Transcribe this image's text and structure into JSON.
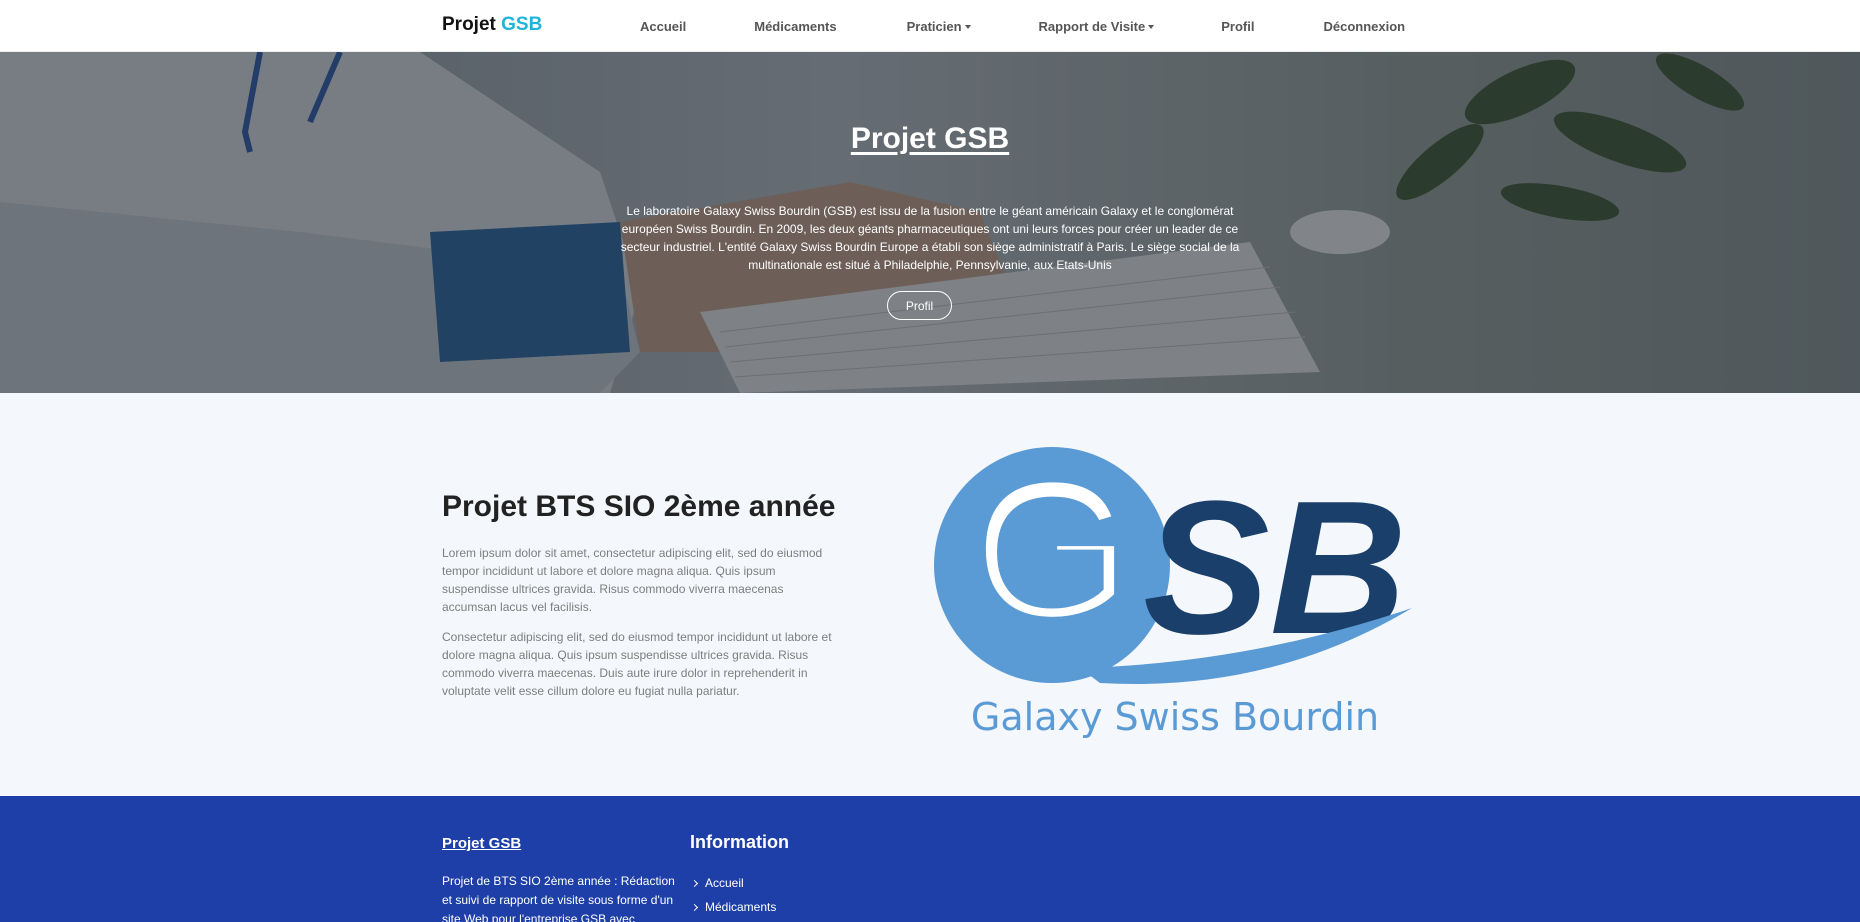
{
  "navbar": {
    "brand_main": "Projet",
    "brand_accent": "GSB",
    "links": [
      {
        "label": "Accueil"
      },
      {
        "label": "Médicaments"
      },
      {
        "label": "Praticien"
      },
      {
        "label": "Rapport de Visite"
      },
      {
        "label": "Profil"
      },
      {
        "label": "Déconnexion"
      }
    ]
  },
  "hero": {
    "title": "Projet GSB",
    "text": "Le laboratoire Galaxy Swiss Bourdin (GSB) est issu de la fusion entre le géant américain Galaxy et le conglomérat européen Swiss Bourdin. En 2009, les deux géants pharmaceutiques ont uni leurs forces pour créer un leader de ce secteur industriel. L'entité Galaxy Swiss Bourdin Europe a établi son siège administratif à Paris. Le siège social de la multinationale est situé à Philadelphie, Pennsylvanie, aux Etats-Unis",
    "button_label": "Profil"
  },
  "about": {
    "title": "Projet BTS SIO 2ème année",
    "paragraph1": "Lorem ipsum dolor sit amet, consectetur adipiscing elit, sed do eiusmod tempor incididunt ut labore et dolore magna aliqua. Quis ipsum suspendisse ultrices gravida. Risus commodo viverra maecenas accumsan lacus vel facilisis.",
    "paragraph2": "Consectetur adipiscing elit, sed do eiusmod tempor incididunt ut labore et dolore magna aliqua. Quis ipsum suspendisse ultrices gravida. Risus commodo viverra maecenas. Duis aute irure dolor in reprehenderit in voluptate velit esse cillum dolore eu fugiat nulla pariatur.",
    "logo": {
      "letters_g": "G",
      "letters_sb": "SB",
      "tagline": "Galaxy Swiss Bourdin",
      "light_blue": "#5b9bd5",
      "dark_blue": "#1a3f6b"
    }
  },
  "footer": {
    "brand": "Projet GSB",
    "description": "Projet de BTS SIO 2ème année : Rédaction et suivi de rapport de visite sous forme d'un site Web pour l'entreprise GSB avec",
    "info_heading": "Information",
    "info_links": [
      {
        "label": "Accueil"
      },
      {
        "label": "Médicaments"
      }
    ]
  },
  "colors": {
    "accent": "#1fb5d9",
    "footer_bg": "#1f3fa8",
    "about_bg": "#f4f7fb"
  }
}
